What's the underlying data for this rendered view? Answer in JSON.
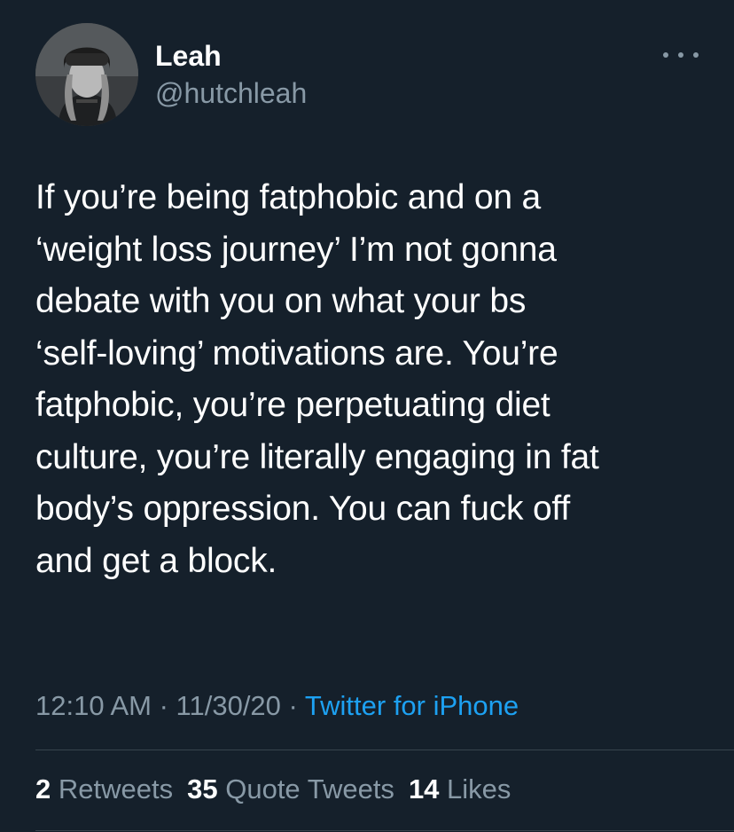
{
  "author": {
    "display_name": "Leah",
    "handle": "@hutchleah",
    "avatar_icon": "profile-photo-avatar"
  },
  "more_icon": "more-horizontal-icon",
  "tweet": {
    "lines": [
      "If you’re being fatphobic and on a",
      "‘weight loss journey’ I’m not gonna",
      "debate with you on what your bs",
      "‘self-loving’ motivations are. You’re",
      "fatphobic, you’re perpetuating diet",
      "culture, you’re literally engaging in fat",
      "body’s oppression. You can fuck off",
      "and get a block."
    ]
  },
  "meta": {
    "time": "12:10 AM",
    "separator1": " · ",
    "date": "11/30/20",
    "separator2": " · ",
    "source": "Twitter for iPhone"
  },
  "stats": {
    "retweets_count": "2",
    "retweets_label": "Retweets",
    "quote_tweets_count": "35",
    "quote_tweets_label": "Quote Tweets",
    "likes_count": "14",
    "likes_label": "Likes"
  },
  "colors": {
    "background": "#15202b",
    "text_primary": "#ffffff",
    "text_secondary": "#8899a6",
    "link": "#1da1f2",
    "divider": "#38444d"
  }
}
